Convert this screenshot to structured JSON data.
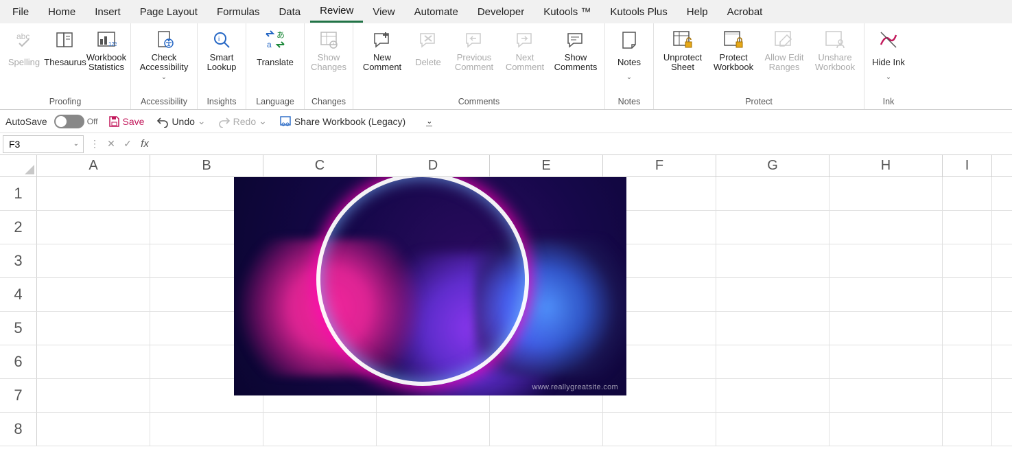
{
  "menu": {
    "items": [
      "File",
      "Home",
      "Insert",
      "Page Layout",
      "Formulas",
      "Data",
      "Review",
      "View",
      "Automate",
      "Developer",
      "Kutools ™",
      "Kutools Plus",
      "Help",
      "Acrobat"
    ],
    "active": "Review"
  },
  "ribbon": {
    "groups": {
      "proofing": {
        "label": "Proofing",
        "spelling": "Spelling",
        "thesaurus": "Thesaurus",
        "workbook_stats": "Workbook Statistics"
      },
      "accessibility": {
        "label": "Accessibility",
        "check_accessibility": "Check Accessibility"
      },
      "insights": {
        "label": "Insights",
        "smart_lookup": "Smart Lookup"
      },
      "language": {
        "label": "Language",
        "translate": "Translate"
      },
      "changes": {
        "label": "Changes",
        "show_changes": "Show Changes"
      },
      "comments": {
        "label": "Comments",
        "new_comment": "New Comment",
        "delete": "Delete",
        "previous_comment": "Previous Comment",
        "next_comment": "Next Comment",
        "show_comments": "Show Comments"
      },
      "notes": {
        "label": "Notes",
        "notes": "Notes"
      },
      "protect": {
        "label": "Protect",
        "unprotect_sheet": "Unprotect Sheet",
        "protect_workbook": "Protect Workbook",
        "allow_edit_ranges": "Allow Edit Ranges",
        "unshare_workbook": "Unshare Workbook"
      },
      "ink": {
        "label": "Ink",
        "hide_ink": "Hide Ink"
      }
    }
  },
  "qat": {
    "autosave_label": "AutoSave",
    "autosave_state": "Off",
    "save": "Save",
    "undo": "Undo",
    "redo": "Redo",
    "share_workbook": "Share Workbook (Legacy)"
  },
  "formula_bar": {
    "name_box": "F3",
    "formula": ""
  },
  "grid": {
    "columns": [
      "A",
      "B",
      "C",
      "D",
      "E",
      "F",
      "G",
      "H",
      "I"
    ],
    "rows": [
      "1",
      "2",
      "3",
      "4",
      "5",
      "6",
      "7",
      "8"
    ]
  },
  "picture": {
    "watermark": "www.reallygreatsite.com"
  }
}
